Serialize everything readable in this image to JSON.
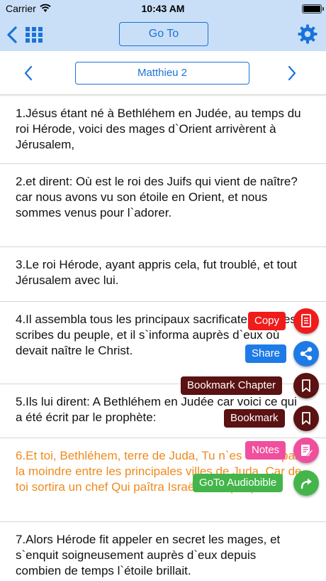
{
  "status_bar": {
    "carrier": "Carrier",
    "time": "10:43 AM"
  },
  "navbar": {
    "goto_label": "Go To"
  },
  "chapter_bar": {
    "chapter_label": "Matthieu 2"
  },
  "verses": [
    {
      "text": "1.Jésus étant né à Bethléhem en Judée, au temps du roi Hérode, voici des mages d`Orient arrivèrent à Jérusalem,"
    },
    {
      "text": "2.et dirent: Où est le roi des Juifs qui vient de naître? car nous avons vu son étoile en Orient, et nous sommes venus pour l`adorer."
    },
    {
      "text": "3.Le roi Hérode, ayant appris cela, fut troublé, et tout Jérusalem avec lui."
    },
    {
      "text": "4.Il assembla tous les principaux sacrificateurs et les scribes du peuple, et il s`informa auprès d`eux où devait naître le Christ."
    },
    {
      "text": "5.Ils lui dirent: A Bethléhem en Judée car voici ce qui a été écrit par le prophète:"
    },
    {
      "text": "6.Et toi, Bethléhem, terre de Juda, Tu n`es certes pas la moindre entre les principales villes de Juda, Car de toi sortira un chef Qui paîtra Israël, mon peuple.",
      "highlighted": true
    },
    {
      "text": "7.Alors Hérode fit appeler en secret les mages, et s`enquit soigneusement auprès d`eux depuis combien de temps l`étoile brillait."
    }
  ],
  "fab_menu": {
    "items": [
      {
        "label": "Copy",
        "icon": "copy-icon",
        "color": "#f01c1c"
      },
      {
        "label": "Share",
        "icon": "share-icon",
        "color": "#1e7be6"
      },
      {
        "label": "Bookmark Chapter",
        "icon": "bookmark-icon",
        "color": "#5a1212"
      },
      {
        "label": "Bookmark",
        "icon": "bookmark-icon",
        "color": "#5a1212"
      },
      {
        "label": "Notes",
        "icon": "notes-icon",
        "color": "#f04f9e"
      },
      {
        "label": "GoTo Audiobible",
        "icon": "goto-arrow-icon",
        "color": "#44b54a"
      }
    ]
  },
  "colors": {
    "accent": "#1a73d9",
    "navbar_bg": "#c9dff7",
    "highlight_text": "#ef8a1d"
  }
}
